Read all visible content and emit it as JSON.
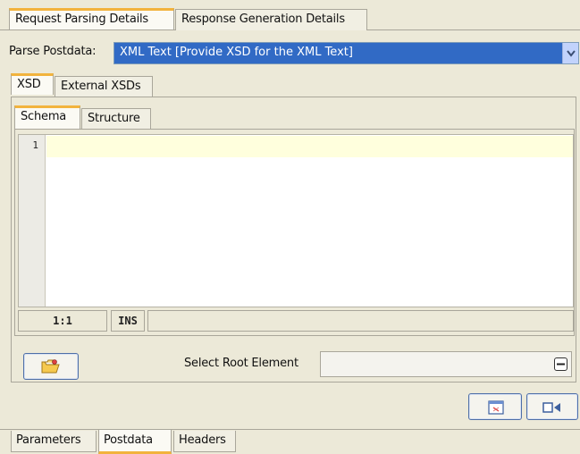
{
  "top_tabs": [
    {
      "label": "Request Parsing Details",
      "active": true
    },
    {
      "label": "Response Generation Details",
      "active": false
    }
  ],
  "parse": {
    "label": "Parse Postdata:",
    "selected": "XML Text  [Provide XSD for the XML Text]"
  },
  "xsd_tabs": [
    {
      "label": "XSD",
      "active": true
    },
    {
      "label": "External XSDs",
      "active": false
    }
  ],
  "schema_tabs": [
    {
      "label": "Schema",
      "active": true
    },
    {
      "label": "Structure",
      "active": false
    }
  ],
  "editor": {
    "line_numbers": [
      "1"
    ],
    "status": {
      "position": "1:1",
      "mode": "INS"
    }
  },
  "root": {
    "label": "Select Root Element",
    "value": ""
  },
  "bottom_tabs": [
    {
      "label": "Parameters",
      "active": false
    },
    {
      "label": "Postdata",
      "active": true
    },
    {
      "label": "Headers",
      "active": false
    }
  ],
  "colors": {
    "background": "#ece9d8",
    "selection": "#316ac5",
    "active_tab_accent": "#f2b33d",
    "current_line": "#ffffdd"
  }
}
